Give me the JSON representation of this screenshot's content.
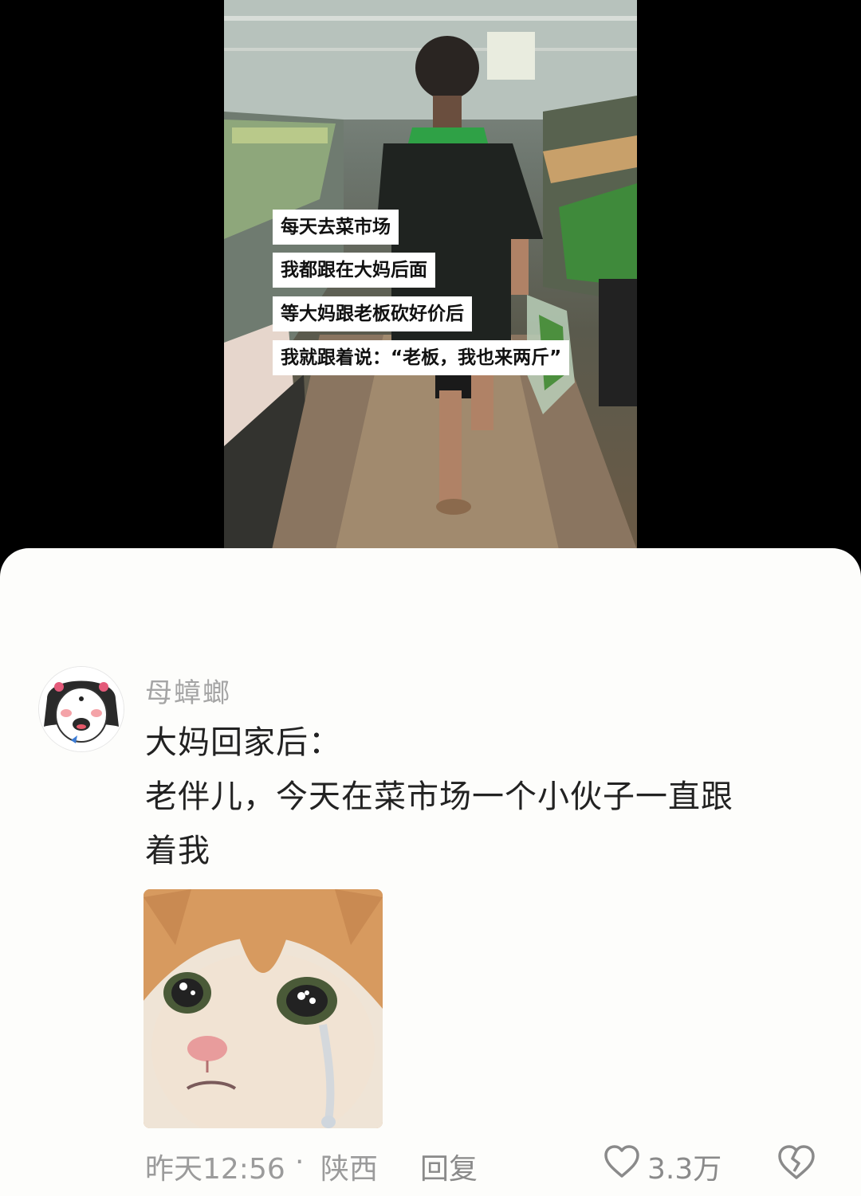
{
  "video": {
    "captions": [
      "每天去菜市场",
      "我都跟在大妈后面",
      "等大妈跟老板砍好价后",
      "我就跟着说：“老板，我也来两斤”"
    ]
  },
  "comment": {
    "username": "母蟑螂",
    "lines": [
      "大妈回家后：",
      "老伴儿，今天在菜市场一个小伙子一直跟",
      "着我"
    ],
    "time": "昨天12:56",
    "separator": "·",
    "region": "陕西",
    "reply_label": "回复",
    "like_count": "3.3万"
  },
  "icons": {
    "avatar": "avatar-cartoon-icon",
    "sticker": "crying-cat-sticker",
    "like": "heart-icon",
    "dislike": "broken-heart-icon"
  }
}
